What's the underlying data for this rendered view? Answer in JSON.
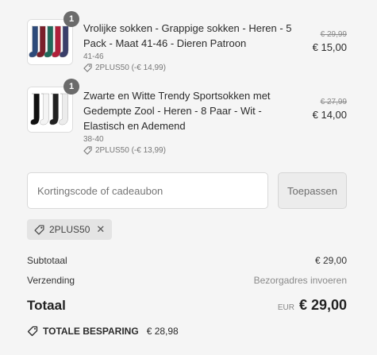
{
  "items": [
    {
      "quantity": "1",
      "title": "Vrolijke sokken - Grappige sokken - Heren - 5 Pack - Maat 41-46 - Dieren Patroon",
      "variant": "41-46",
      "discount": "2PLUS50 (-€ 14,99)",
      "old_price": "€ 29,99",
      "price": "€ 15,00",
      "sock_colors": [
        "#2d4a7a",
        "#7a1f2a",
        "#1f6a5a",
        "#b0203a",
        "#3a3f6a"
      ]
    },
    {
      "quantity": "1",
      "title": "Zwarte en Witte Trendy Sportsokken met Gedempte Zool - Heren - 8 Paar - Wit - Elastisch en Ademend",
      "variant": "38-40",
      "discount": "2PLUS50 (-€ 13,99)",
      "old_price": "€ 27,99",
      "price": "€ 14,00",
      "sock_colors": [
        "#111111",
        "#f4f4f4",
        "#222222",
        "#ececec"
      ]
    }
  ],
  "coupon": {
    "placeholder": "Kortingscode of cadeaubon",
    "value": "",
    "apply_label": "Toepassen"
  },
  "applied_code": "2PLUS50",
  "summary": {
    "subtotal_label": "Subtotaal",
    "subtotal_value": "€ 29,00",
    "shipping_label": "Verzending",
    "shipping_value": "Bezorgadres invoeren",
    "total_label": "Totaal",
    "currency": "EUR",
    "total_value": "€ 29,00",
    "savings_label": "TOTALE BESPARING",
    "savings_value": "€ 28,98"
  },
  "colors": {
    "background": "#f5f5f5",
    "badge": "#6b6b6b",
    "text": "#2b2b2b",
    "muted": "#8a8a8a"
  }
}
